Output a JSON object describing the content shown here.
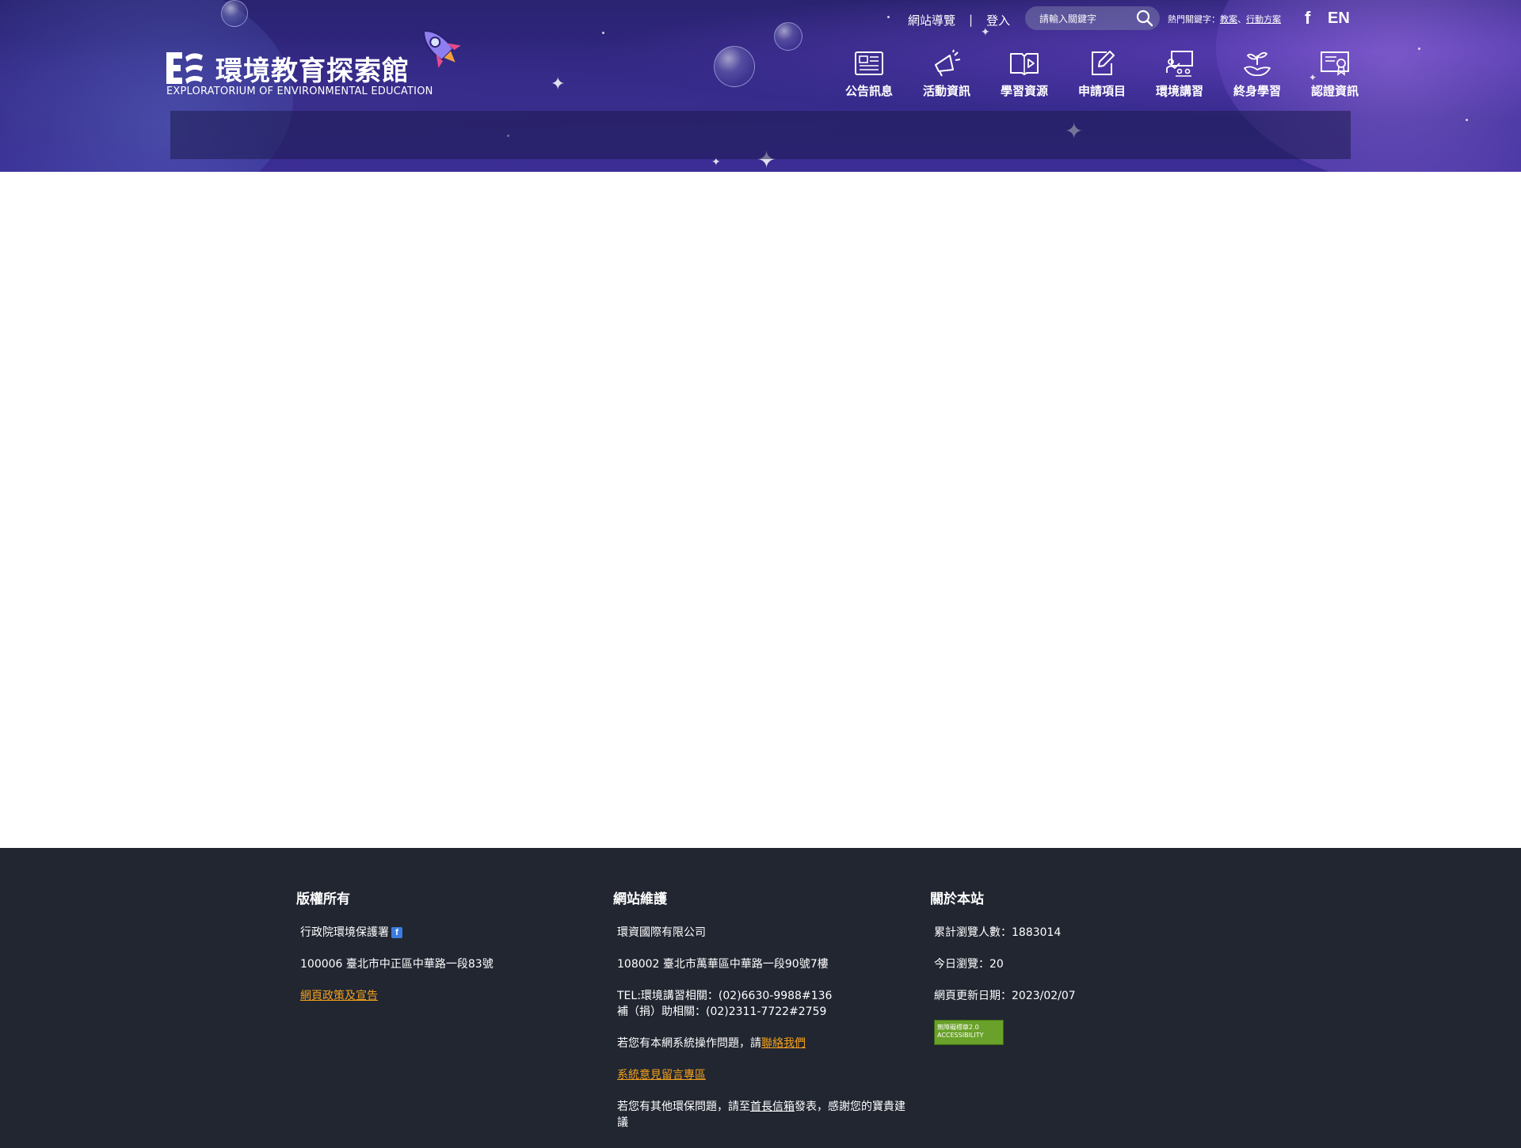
{
  "site": {
    "title": "環境教育探索館",
    "subtitle": "EXPLORATORIUM OF ENVIRONMENTAL EDUCATION"
  },
  "toplinks": {
    "sitemap": "網站導覽",
    "separator": "|",
    "login": "登入"
  },
  "search": {
    "placeholder": "請輸入關鍵字"
  },
  "hot_keywords": {
    "label": "熱門關鍵字：",
    "items": [
      "教案",
      "行動方案"
    ],
    "separator": "、"
  },
  "social": {
    "facebook": "f",
    "language": "EN"
  },
  "nav": {
    "items": [
      {
        "label": "公告訊息",
        "icon": "newspaper-icon"
      },
      {
        "label": "活動資訊",
        "icon": "megaphone-icon"
      },
      {
        "label": "學習資源",
        "icon": "book-play-icon"
      },
      {
        "label": "申請項目",
        "icon": "edit-icon"
      },
      {
        "label": "環境講習",
        "icon": "lecture-icon"
      },
      {
        "label": "終身學習",
        "icon": "sprout-hand-icon"
      },
      {
        "label": "認證資訊",
        "icon": "certificate-icon"
      }
    ]
  },
  "footer": {
    "copyright": {
      "heading": "版權所有",
      "org": "行政院環境保護署",
      "address": "100006 臺北市中正區中華路一段83號",
      "policy_link": "網頁政策及宣告"
    },
    "maintenance": {
      "heading": "網站維護",
      "company": "環資國際有限公司",
      "address": "108002 臺北市萬華區中華路一段90號7樓",
      "tel_line1": "TEL:環境講習相關：(02)6630-9988#136",
      "tel_line2": "補（捐）助相關：(02)2311-7722#2759",
      "contact_prefix": "若您有本網系統操作問題，請",
      "contact_link": "聯絡我們",
      "message_board_link": "系統意見留言專區",
      "other_prefix": "若您有其他環保問題，請至",
      "mailbox_link": "首長信箱",
      "other_suffix": "發表，感謝您的寶貴建議"
    },
    "about": {
      "heading": "關於本站",
      "total_views": "累計瀏覽人數：1883014",
      "today_views": "今日瀏覽：20",
      "updated": "網頁更新日期：2023/02/07",
      "badge": "無障礙標章2.0 ACCESSIBILITY"
    }
  },
  "colors": {
    "header_bg": "#2e2580",
    "footer_bg": "#212631",
    "link_accent": "#f4a11c"
  }
}
